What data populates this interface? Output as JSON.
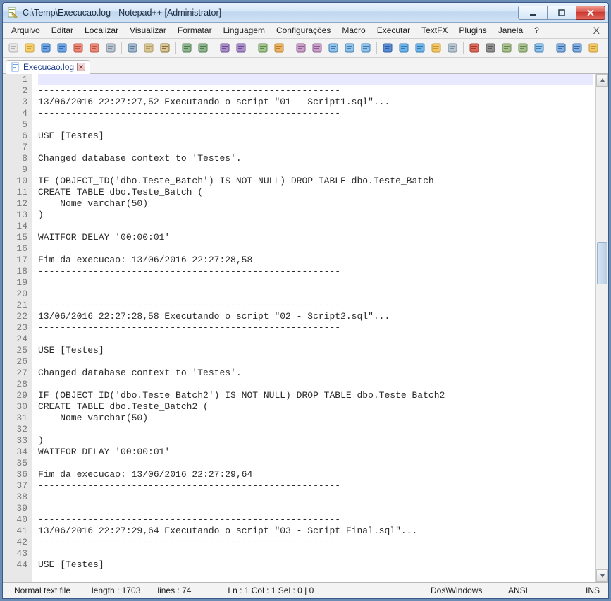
{
  "window": {
    "title": "C:\\Temp\\Execucao.log - Notepad++ [Administrator]"
  },
  "menubar": {
    "items": [
      "Arquivo",
      "Editar",
      "Localizar",
      "Visualizar",
      "Formatar",
      "Linguagem",
      "Configurações",
      "Macro",
      "Executar",
      "TextFX",
      "Plugins",
      "Janela",
      "?"
    ]
  },
  "tabs": {
    "active": {
      "label": "Execucao.log"
    }
  },
  "editor": {
    "lines": [
      "",
      "-------------------------------------------------------",
      "13/06/2016 22:27:27,52 Executando o script \"01 - Script1.sql\"...",
      "-------------------------------------------------------",
      "",
      "USE [Testes]",
      "",
      "Changed database context to 'Testes'.",
      "",
      "IF (OBJECT_ID('dbo.Teste_Batch') IS NOT NULL) DROP TABLE dbo.Teste_Batch",
      "CREATE TABLE dbo.Teste_Batch (",
      "    Nome varchar(50)",
      ")",
      "",
      "WAITFOR DELAY '00:00:01'",
      "",
      "Fim da execucao: 13/06/2016 22:27:28,58",
      "-------------------------------------------------------",
      "",
      "",
      "-------------------------------------------------------",
      "13/06/2016 22:27:28,58 Executando o script \"02 - Script2.sql\"...",
      "-------------------------------------------------------",
      "",
      "USE [Testes]",
      "",
      "Changed database context to 'Testes'.",
      "",
      "IF (OBJECT_ID('dbo.Teste_Batch2') IS NOT NULL) DROP TABLE dbo.Teste_Batch2",
      "CREATE TABLE dbo.Teste_Batch2 (",
      "    Nome varchar(50)",
      "",
      ")",
      "WAITFOR DELAY '00:00:01'",
      "",
      "Fim da execucao: 13/06/2016 22:27:29,64",
      "-------------------------------------------------------",
      "",
      "",
      "-------------------------------------------------------",
      "13/06/2016 22:27:29,64 Executando o script \"03 - Script Final.sql\"...",
      "-------------------------------------------------------",
      "",
      "USE [Testes]"
    ],
    "visible_lines": 44
  },
  "statusbar": {
    "filetype": "Normal text file",
    "length_label": "length : 1703",
    "lines_label": "lines : 74",
    "position": "Ln : 1    Col : 1    Sel : 0 | 0",
    "eol": "Dos\\Windows",
    "encoding": "ANSI",
    "insert_mode": "INS"
  },
  "toolbar_icons": [
    {
      "name": "new-file-icon",
      "fg": "#e6e6e6",
      "accent": "#b0b0b0"
    },
    {
      "name": "open-file-icon",
      "fg": "#f6cf6b",
      "accent": "#caa13c"
    },
    {
      "name": "save-icon",
      "fg": "#6fa3e0",
      "accent": "#2f6bb5"
    },
    {
      "name": "save-all-icon",
      "fg": "#6fa3e0",
      "accent": "#2f6bb5"
    },
    {
      "name": "close-file-icon",
      "fg": "#e88a7a",
      "accent": "#c0533f"
    },
    {
      "name": "close-all-icon",
      "fg": "#e88a7a",
      "accent": "#c0533f"
    },
    {
      "name": "print-icon",
      "fg": "#b8c3cf",
      "accent": "#7d8a97"
    },
    {
      "sep": true
    },
    {
      "name": "cut-icon",
      "fg": "#9fb6cd",
      "accent": "#5f7c97"
    },
    {
      "name": "copy-icon",
      "fg": "#d8c69a",
      "accent": "#b09a5f"
    },
    {
      "name": "paste-icon",
      "fg": "#d8c69a",
      "accent": "#8a7030"
    },
    {
      "sep": true
    },
    {
      "name": "undo-icon",
      "fg": "#8fb48f",
      "accent": "#4c7c4c"
    },
    {
      "name": "redo-icon",
      "fg": "#8fb48f",
      "accent": "#4c7c4c"
    },
    {
      "sep": true
    },
    {
      "name": "find-icon",
      "fg": "#a98ec6",
      "accent": "#6c4c96"
    },
    {
      "name": "replace-icon",
      "fg": "#a98ec6",
      "accent": "#6c4c96"
    },
    {
      "sep": true
    },
    {
      "name": "zoom-in-icon",
      "fg": "#a0c58e",
      "accent": "#5c8a44"
    },
    {
      "name": "zoom-out-icon",
      "fg": "#e8b46b",
      "accent": "#c07f20"
    },
    {
      "sep": true
    },
    {
      "name": "sync-v-icon",
      "fg": "#c9a0c9",
      "accent": "#8f5c8f"
    },
    {
      "name": "sync-h-icon",
      "fg": "#c9a0c9",
      "accent": "#8f5c8f"
    },
    {
      "name": "word-wrap-icon",
      "fg": "#92c2e6",
      "accent": "#3c7cb5"
    },
    {
      "name": "all-chars-icon",
      "fg": "#92c2e6",
      "accent": "#3c7cb5"
    },
    {
      "name": "indent-guide-icon",
      "fg": "#92c2e6",
      "accent": "#3c7cb5"
    },
    {
      "sep": true
    },
    {
      "name": "lang-user-icon",
      "fg": "#5b8bd0",
      "accent": "#2f5ca0"
    },
    {
      "name": "doc-map-icon",
      "fg": "#6fb2e6",
      "accent": "#2f7cb5"
    },
    {
      "name": "func-list-icon",
      "fg": "#6fb2e6",
      "accent": "#2f7cb5"
    },
    {
      "name": "folder-panel-icon",
      "fg": "#f0c76b",
      "accent": "#c8972c"
    },
    {
      "name": "monitoring-icon",
      "fg": "#b7c5d3",
      "accent": "#7a8ca0"
    },
    {
      "sep": true
    },
    {
      "name": "record-macro-icon",
      "fg": "#d96b5c",
      "accent": "#a83a2c"
    },
    {
      "name": "stop-macro-icon",
      "fg": "#8f8f8f",
      "accent": "#5c5c5c"
    },
    {
      "name": "play-macro-icon",
      "fg": "#a8c090",
      "accent": "#6c8a50"
    },
    {
      "name": "play-multi-icon",
      "fg": "#a8c090",
      "accent": "#6c8a50"
    },
    {
      "name": "save-macro-icon",
      "fg": "#92c2e6",
      "accent": "#3c7cb5"
    },
    {
      "sep": true
    },
    {
      "name": "plugin1-icon",
      "fg": "#7fb0e0",
      "accent": "#3c6ca8"
    },
    {
      "name": "plugin2-icon",
      "fg": "#7fb0e0",
      "accent": "#3c6ca8"
    },
    {
      "name": "dropdown-icon",
      "fg": "#f0c76b",
      "accent": "#c8972c"
    }
  ]
}
